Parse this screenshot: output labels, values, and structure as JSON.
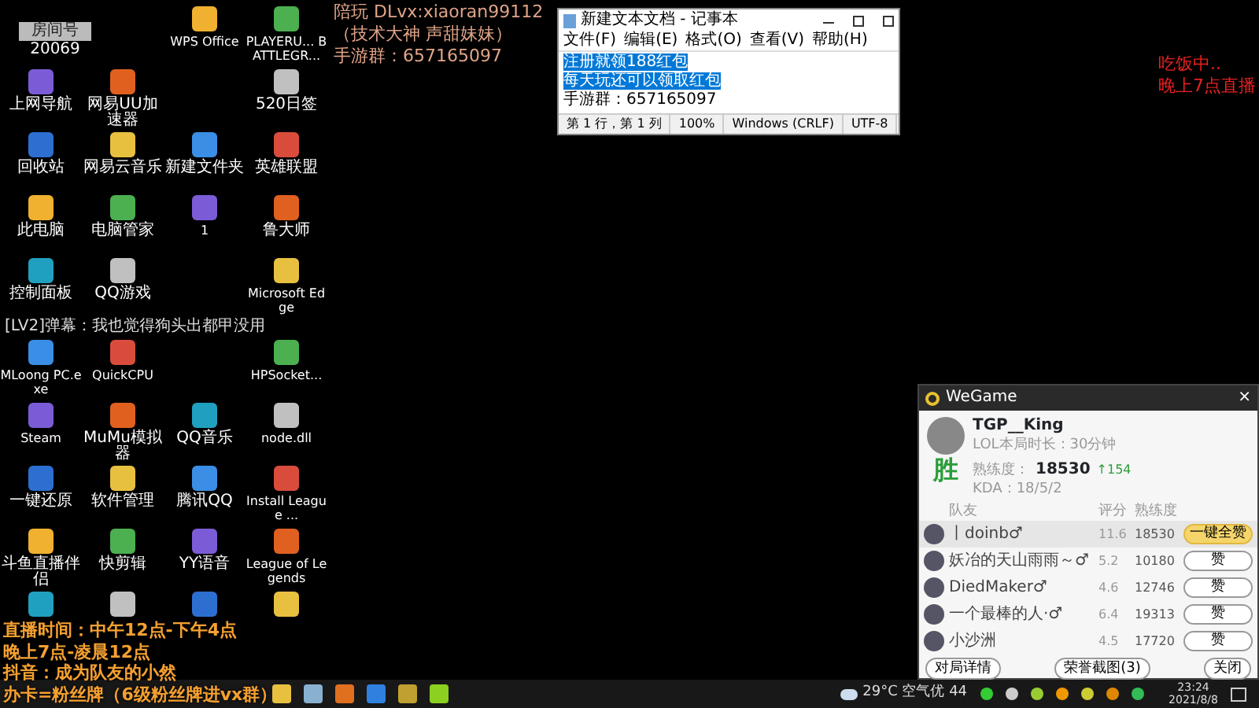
{
  "stream_logo": {
    "label": "房间号",
    "room": "20069"
  },
  "desktop": {
    "rows": [
      [
        null,
        null,
        {
          "label": "WPS Office"
        },
        {
          "label": "PLAYERU... BATTLEGR..."
        }
      ],
      [
        {
          "label": "上网导航"
        },
        {
          "label": "网易UU加速器"
        },
        null,
        {
          "label": "520日签"
        }
      ],
      [
        {
          "label": "回收站"
        },
        {
          "label": "网易云音乐"
        },
        {
          "label": "新建文件夹"
        },
        {
          "label": "英雄联盟"
        }
      ],
      [
        {
          "label": "此电脑"
        },
        {
          "label": "电脑管家"
        },
        {
          "label": "1"
        },
        {
          "label": "鲁大师"
        }
      ],
      [
        {
          "label": "控制面板"
        },
        {
          "label": "QQ游戏"
        },
        null,
        {
          "label": "Microsoft Edge"
        }
      ],
      [
        {
          "label": "MLoong PC.exe"
        },
        {
          "label": "QuickCPU"
        },
        null,
        {
          "label": "HPSocket..."
        }
      ],
      [
        {
          "label": "Steam"
        },
        {
          "label": "MuMu模拟器"
        },
        {
          "label": "QQ音乐"
        },
        {
          "label": "node.dll"
        }
      ],
      [
        {
          "label": "一键还原"
        },
        {
          "label": "软件管理"
        },
        {
          "label": "腾讯QQ"
        },
        {
          "label": "Install League ..."
        }
      ],
      [
        {
          "label": "斗鱼直播伴侣"
        },
        {
          "label": "快剪辑"
        },
        {
          "label": "YY语音"
        },
        {
          "label": "League of Legends"
        }
      ],
      [
        {},
        {},
        {},
        {}
      ]
    ],
    "danmaku": "[LV2]弹幕：我也觉得狗头出都甲没用"
  },
  "overlay_top": [
    "陪玩 DLvx:xiaoran99112",
    "（技术大神 声甜妹妹）",
    "手游群：657165097"
  ],
  "overlay_right": [
    "吃饭中..",
    "晚上7点直播"
  ],
  "overlay_bottom": [
    "直播时间：中午12点-下午4点",
    "晚上7点-凌晨12点",
    "抖音：成为队友的小然",
    "办卡=粉丝牌（6级粉丝牌进vx群）"
  ],
  "notepad": {
    "title": "新建文本文档 - 记事本",
    "menus": [
      "文件(F)",
      "编辑(E)",
      "格式(O)",
      "查看(V)",
      "帮助(H)"
    ],
    "lines": [
      {
        "text": "注册就领188红包",
        "selected": true
      },
      {
        "text": "每天玩还可以领取红包",
        "selected": true
      },
      {
        "text": "手游群：657165097",
        "selected": false
      }
    ],
    "status": [
      "第 1 行，第 1 列",
      "100%",
      "Windows (CRLF)",
      "UTF-8"
    ]
  },
  "wegame": {
    "title": "WeGame",
    "close": "×",
    "user": "TGP__King",
    "duration": "LOL本局时长：30分钟",
    "result": "胜",
    "stat_label": "熟练度：",
    "stat_value": "18530",
    "stat_delta": "↑154",
    "kda": "KDA：18/5/2",
    "columns": [
      "队友",
      "评分",
      "熟练度"
    ],
    "rows": [
      {
        "name": "丨doinb♂",
        "score": "11.6",
        "proficiency": "18530",
        "button": "一键全赞",
        "kind": "primary",
        "selected": true
      },
      {
        "name": "妖冶的天山雨雨～♂",
        "score": "5.2",
        "proficiency": "10180",
        "button": "赞",
        "kind": "plain",
        "selected": false
      },
      {
        "name": "DiedMaker♂",
        "score": "4.6",
        "proficiency": "12746",
        "button": "赞",
        "kind": "plain",
        "selected": false
      },
      {
        "name": "一个最棒的人·♂",
        "score": "6.4",
        "proficiency": "19313",
        "button": "赞",
        "kind": "plain",
        "selected": false
      },
      {
        "name": "小沙洲",
        "score": "4.5",
        "proficiency": "17720",
        "button": "赞",
        "kind": "plain",
        "selected": false
      }
    ],
    "footer": [
      "对局详情",
      "荣誉截图(3)",
      "关闭"
    ]
  },
  "taskbar": {
    "weather": "29°C 空气优 44",
    "time": "23:24",
    "date": "2021/8/8"
  }
}
